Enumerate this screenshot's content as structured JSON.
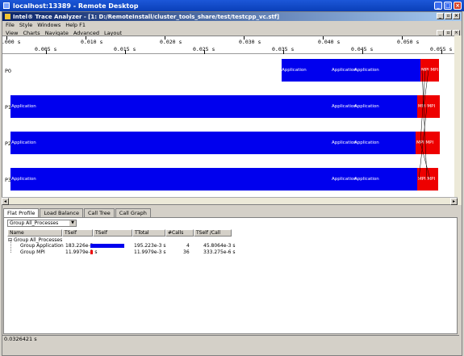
{
  "rdp": {
    "title": "localhost:13389 - Remote Desktop"
  },
  "app": {
    "title": "Intel® Trace Analyzer - [1: D:/RemoteInstall/cluster_tools_share/test/testcpp_vc.stf]"
  },
  "menu_top": [
    "File",
    "Style",
    "Windows",
    "Help F1"
  ],
  "menu_inner": [
    "View",
    "Charts",
    "Navigate",
    "Advanced",
    "Layout"
  ],
  "ruler": {
    "top_labels": [
      ".000 s",
      "0.010 s",
      "0.020 s",
      "0.030 s",
      "0.040 s",
      "0.050 s"
    ],
    "bottom_labels": [
      "0.005 s",
      "0.015 s",
      "0.025 s",
      "0.035 s",
      "0.045 s",
      "0.055 s"
    ]
  },
  "processes": [
    {
      "name": "P0",
      "app_texts": [
        "Application",
        "Application",
        "Application"
      ],
      "mpi_text": "MPI MPI"
    },
    {
      "name": "P1",
      "app_texts": [
        "Application",
        "Application",
        "Application"
      ],
      "mpi_text": "MPI MPI"
    },
    {
      "name": "P2",
      "app_texts": [
        "Application",
        "Application",
        "Application"
      ],
      "mpi_text": "MPI MPI"
    },
    {
      "name": "P3",
      "app_texts": [
        "Application",
        "Application",
        "Application"
      ],
      "mpi_text": "MPI MPI"
    }
  ],
  "colors": {
    "application": "#0000ee",
    "mpi": "#ee0000"
  },
  "tabs": [
    "Flat Profile",
    "Load Balance",
    "Call Tree",
    "Call Graph"
  ],
  "active_tab": "Flat Profile",
  "group_select": "Group All_Processes",
  "table": {
    "headers": [
      "Name",
      "TSelf",
      "TSelf",
      "TTotal",
      "#Calls",
      "TSelf /Call"
    ],
    "group_root": "Group All_Processes",
    "rows": [
      {
        "name": "Group Application",
        "tself": "183.226e-3 s",
        "tself_fraction": 0.94,
        "ttotal": "195.223e-3 s",
        "calls": "4",
        "tself_per_call": "45.8064e-3 s",
        "color": "#0000ee"
      },
      {
        "name": "Group MPI",
        "tself": "11.9979e-3 s",
        "tself_fraction": 0.06,
        "ttotal": "11.9979e-3 s",
        "calls": "36",
        "tself_per_call": "333.275e-6 s",
        "color": "#ee0000"
      }
    ]
  },
  "status": "0.0326421 s"
}
